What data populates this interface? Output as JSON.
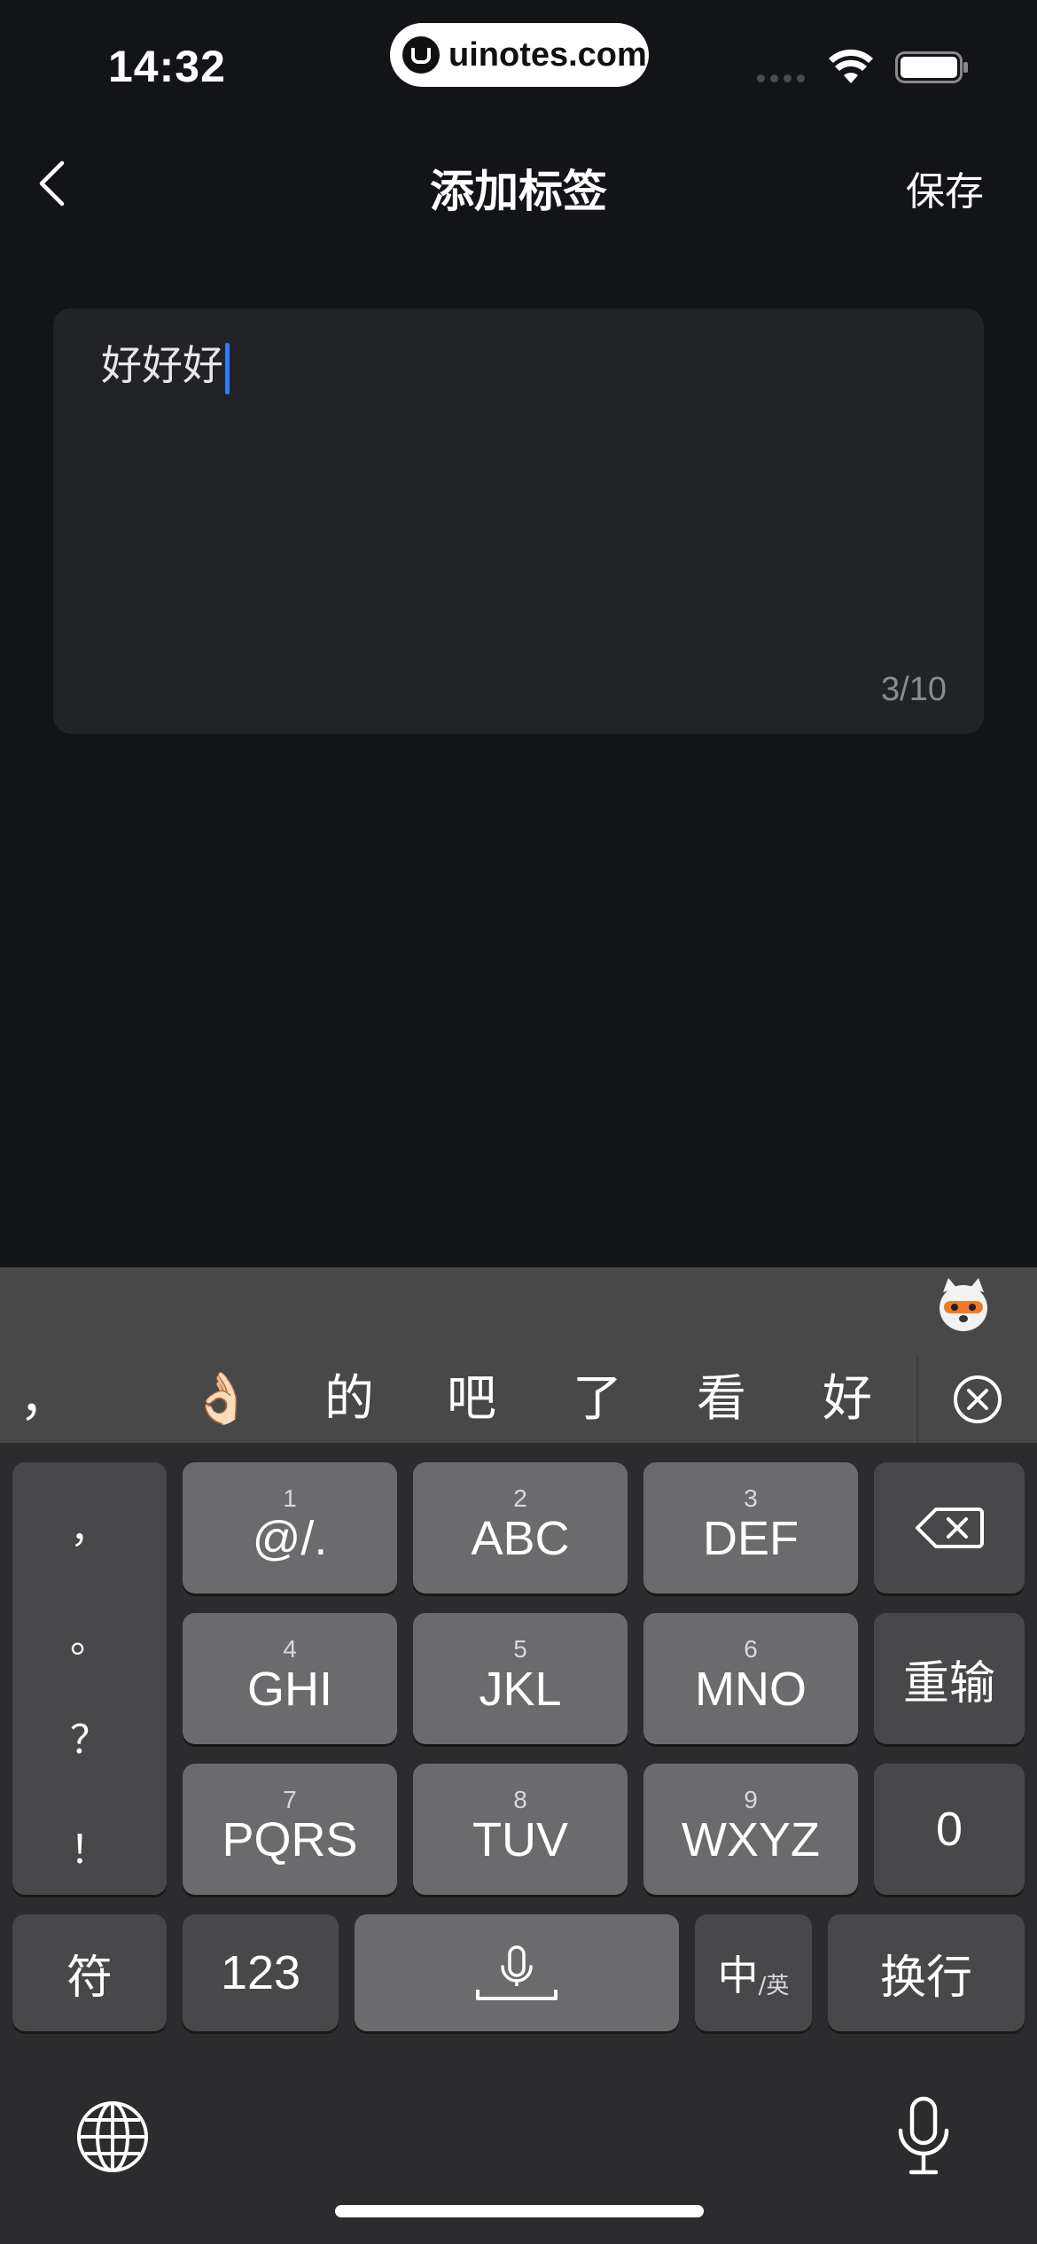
{
  "status_bar": {
    "time": "14:32",
    "watermark": "uinotes.com",
    "icons": [
      "cellular-signal-icon",
      "wifi-icon",
      "battery-icon"
    ]
  },
  "nav": {
    "back_icon": "chevron-left-icon",
    "title": "添加标签",
    "save_label": "保存"
  },
  "input": {
    "value": "好好好",
    "char_count": "3/10",
    "caret_color": "#2f7cf6"
  },
  "keyboard": {
    "candidates": [
      "，",
      "👌🏻",
      "的",
      "吧",
      "了",
      "看",
      "好"
    ],
    "clear_icon": "circle-x-icon",
    "mascot_icon": "ime-mascot-icon",
    "punctuation": [
      "，",
      "。",
      "？",
      "！"
    ],
    "keys": [
      {
        "num": "1",
        "letters": "@/."
      },
      {
        "num": "2",
        "letters": "ABC"
      },
      {
        "num": "3",
        "letters": "DEF"
      },
      {
        "num": "4",
        "letters": "GHI"
      },
      {
        "num": "5",
        "letters": "JKL"
      },
      {
        "num": "6",
        "letters": "MNO"
      },
      {
        "num": "7",
        "letters": "PQRS"
      },
      {
        "num": "8",
        "letters": "TUV"
      },
      {
        "num": "9",
        "letters": "WXYZ"
      }
    ],
    "backspace_icon": "backspace-icon",
    "reinput_label": "重输",
    "zero_label": "0",
    "symbol_label": "符",
    "numbers_label": "123",
    "space_icon": "microphone-space-icon",
    "lang_main": "中",
    "lang_sub": "/英",
    "return_label": "换行",
    "globe_icon": "globe-icon",
    "dictation_icon": "microphone-icon"
  }
}
